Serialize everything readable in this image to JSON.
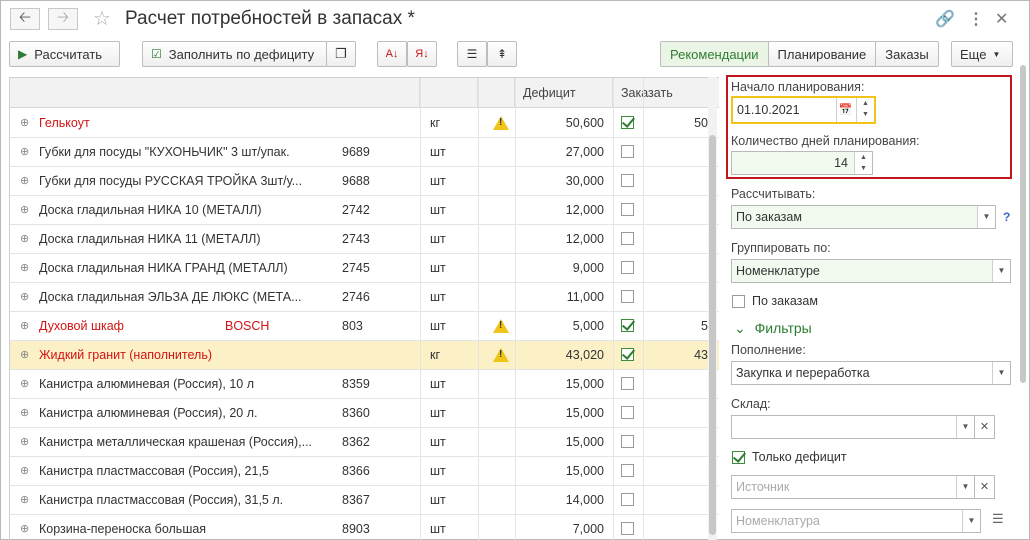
{
  "window": {
    "title": "Расчет потребностей в запасах *"
  },
  "toolbar": {
    "calculate_label": "Рассчитать",
    "fill_label": "Заполнить по дефициту",
    "views": [
      "Рекомендации",
      "Планирование",
      "Заказы"
    ],
    "active_view": "Рекомендации",
    "more_label": "Еще"
  },
  "table": {
    "headers": {
      "deficit": "Дефицит",
      "order": "Заказать"
    },
    "rows": [
      {
        "name": "Гелькоут",
        "brand": "",
        "article": "",
        "unit": "кг",
        "warning": true,
        "deficit": "50,600",
        "checked": true,
        "order": "50",
        "red": true
      },
      {
        "name": "Губки для посуды \"КУХОНЬЧИК\" 3 шт/упак.",
        "brand": "",
        "article": "9689",
        "unit": "шт",
        "warning": false,
        "deficit": "27,000",
        "checked": false,
        "order": "",
        "red": false
      },
      {
        "name": "Губки для посуды РУССКАЯ ТРОЙКА 3шт/у...",
        "brand": "",
        "article": "9688",
        "unit": "шт",
        "warning": false,
        "deficit": "30,000",
        "checked": false,
        "order": "",
        "red": false
      },
      {
        "name": "Доска гладильная  НИКА 10 (МЕТАЛЛ)",
        "brand": "",
        "article": "2742",
        "unit": "шт",
        "warning": false,
        "deficit": "12,000",
        "checked": false,
        "order": "",
        "red": false
      },
      {
        "name": "Доска гладильная  НИКА 11 (МЕТАЛЛ)",
        "brand": "",
        "article": "2743",
        "unit": "шт",
        "warning": false,
        "deficit": "12,000",
        "checked": false,
        "order": "",
        "red": false
      },
      {
        "name": "Доска гладильная  НИКА ГРАНД (МЕТАЛЛ)",
        "brand": "",
        "article": "2745",
        "unit": "шт",
        "warning": false,
        "deficit": "9,000",
        "checked": false,
        "order": "",
        "red": false
      },
      {
        "name": "Доска гладильная  ЭЛЬЗА ДЕ ЛЮКС (МЕТА...",
        "brand": "",
        "article": "2746",
        "unit": "шт",
        "warning": false,
        "deficit": "11,000",
        "checked": false,
        "order": "",
        "red": false
      },
      {
        "name": "Духовой шкаф",
        "brand": "BOSCH",
        "article": "803",
        "unit": "шт",
        "warning": true,
        "deficit": "5,000",
        "checked": true,
        "order": "5",
        "red": true
      },
      {
        "name": "Жидкий гранит (наполнитель)",
        "brand": "",
        "article": "",
        "unit": "кг",
        "warning": true,
        "deficit": "43,020",
        "checked": true,
        "order": "43",
        "red": true,
        "selected": true
      },
      {
        "name": "Канистра алюминевая (Россия), 10 л",
        "brand": "",
        "article": "8359",
        "unit": "шт",
        "warning": false,
        "deficit": "15,000",
        "checked": false,
        "order": "",
        "red": false
      },
      {
        "name": "Канистра алюминевая (Россия), 20 л.",
        "brand": "",
        "article": "8360",
        "unit": "шт",
        "warning": false,
        "deficit": "15,000",
        "checked": false,
        "order": "",
        "red": false
      },
      {
        "name": "Канистра металлическая крашеная (Россия),...",
        "brand": "",
        "article": "8362",
        "unit": "шт",
        "warning": false,
        "deficit": "15,000",
        "checked": false,
        "order": "",
        "red": false
      },
      {
        "name": "Канистра пластмассовая (Россия), 21,5",
        "brand": "",
        "article": "8366",
        "unit": "шт",
        "warning": false,
        "deficit": "15,000",
        "checked": false,
        "order": "",
        "red": false
      },
      {
        "name": "Канистра пластмассовая (Россия), 31,5 л.",
        "brand": "",
        "article": "8367",
        "unit": "шт",
        "warning": false,
        "deficit": "14,000",
        "checked": false,
        "order": "",
        "red": false
      },
      {
        "name": "Корзина-переноска большая",
        "brand": "",
        "article": "8903",
        "unit": "шт",
        "warning": false,
        "deficit": "7,000",
        "checked": false,
        "order": "",
        "red": false
      }
    ]
  },
  "panel": {
    "start_label": "Начало планирования:",
    "start_value": "01.10.2021",
    "days_label": "Количество дней планирования:",
    "days_value": "14",
    "calc_label": "Рассчитывать:",
    "calc_value": "По заказам",
    "group_label": "Группировать по:",
    "group_value": "Номенклатуре",
    "by_orders_label": "По заказам",
    "by_orders_checked": false,
    "filters_title": "Фильтры",
    "replenish_label": "Пополнение:",
    "replenish_value": "Закупка и переработка",
    "warehouse_label": "Склад:",
    "warehouse_value": "",
    "only_deficit_label": "Только дефицит",
    "only_deficit_checked": true,
    "source_placeholder": "Источник",
    "nomenclature_placeholder": "Номенклатура",
    "help": "?"
  },
  "colors": {
    "accent_green": "#2e7d32",
    "warning_red": "#d21414",
    "highlight_border": "#c0171b",
    "selected_row": "#fbf0c6"
  }
}
